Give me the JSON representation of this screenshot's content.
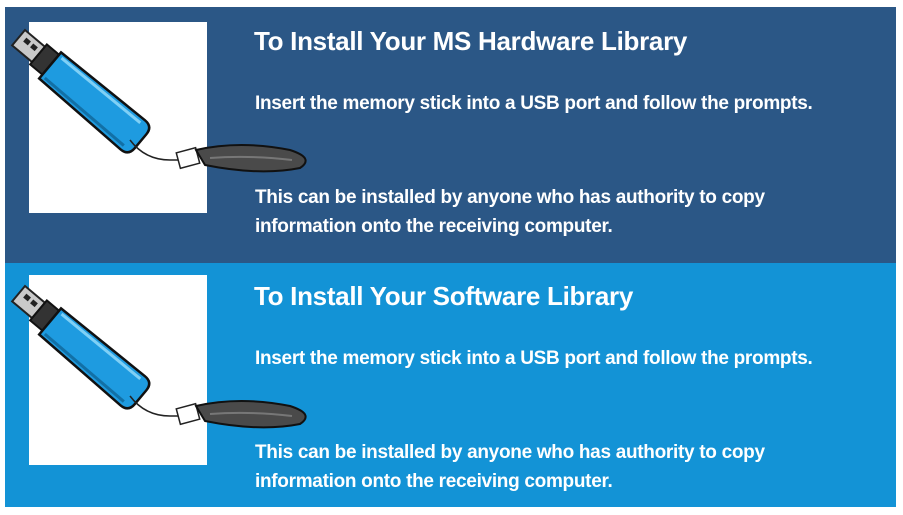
{
  "sections": [
    {
      "title": "To Install Your MS Hardware Library",
      "instruction": "Insert the memory stick into a USB port and follow the prompts.",
      "note_line1": "This can be installed by anyone who has authority to copy",
      "note_line2": "information onto the receiving computer.",
      "icon": "usb-memory-stick-icon"
    },
    {
      "title": "To Install Your Software Library",
      "instruction": "Insert the memory stick into a USB port and follow the prompts.",
      "note_line1": "This can be installed by anyone who has authority to copy",
      "note_line2": "information onto the receiving computer.",
      "icon": "usb-memory-stick-icon"
    }
  ],
  "colors": {
    "top_panel": "#2b5786",
    "bottom_panel": "#1393d6",
    "usb_body": "#1e9be0",
    "lanyard": "#4a4a4a"
  }
}
